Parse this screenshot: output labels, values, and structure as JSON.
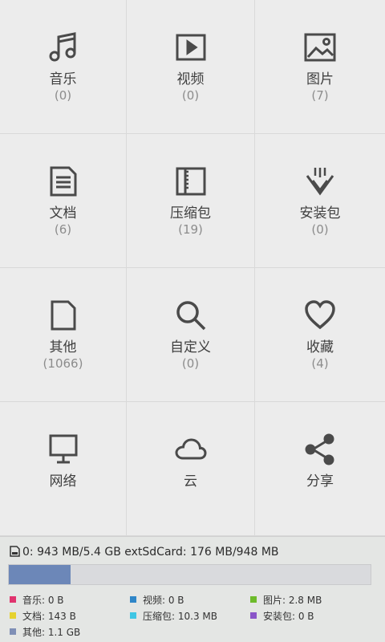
{
  "categories": [
    {
      "label": "音乐",
      "count": "(0)",
      "icon": "music-icon"
    },
    {
      "label": "视频",
      "count": "(0)",
      "icon": "video-icon"
    },
    {
      "label": "图片",
      "count": "(7)",
      "icon": "picture-icon"
    },
    {
      "label": "文档",
      "count": "(6)",
      "icon": "document-icon"
    },
    {
      "label": "压缩包",
      "count": "(19)",
      "icon": "archive-icon"
    },
    {
      "label": "安装包",
      "count": "(0)",
      "icon": "apk-download-icon"
    },
    {
      "label": "其他",
      "count": "(1066)",
      "icon": "file-icon"
    },
    {
      "label": "自定义",
      "count": "(0)",
      "icon": "search-icon"
    },
    {
      "label": "收藏",
      "count": "(4)",
      "icon": "heart-icon"
    },
    {
      "label": "网络",
      "count": "",
      "icon": "monitor-icon"
    },
    {
      "label": "云",
      "count": "",
      "icon": "cloud-icon"
    },
    {
      "label": "分享",
      "count": "",
      "icon": "share-icon"
    }
  ],
  "storage": {
    "summary": "0: 943 MB/5.4 GB  extSdCard: 176 MB/948 MB",
    "used_fraction": 0.17,
    "bar_color": "#6c87b8",
    "legend": [
      {
        "label": "音乐: 0 B",
        "color": "#e0336e"
      },
      {
        "label": "视频: 0 B",
        "color": "#2f86c8"
      },
      {
        "label": "图片: 2.8 MB",
        "color": "#6dbb2a"
      },
      {
        "label": "文档: 143 B",
        "color": "#e6d230"
      },
      {
        "label": "压缩包: 10.3 MB",
        "color": "#3fc6e4"
      },
      {
        "label": "安装包: 0 B",
        "color": "#8a55c8"
      },
      {
        "label": "其他: 1.1 GB",
        "color": "#7f8fb6"
      }
    ]
  }
}
